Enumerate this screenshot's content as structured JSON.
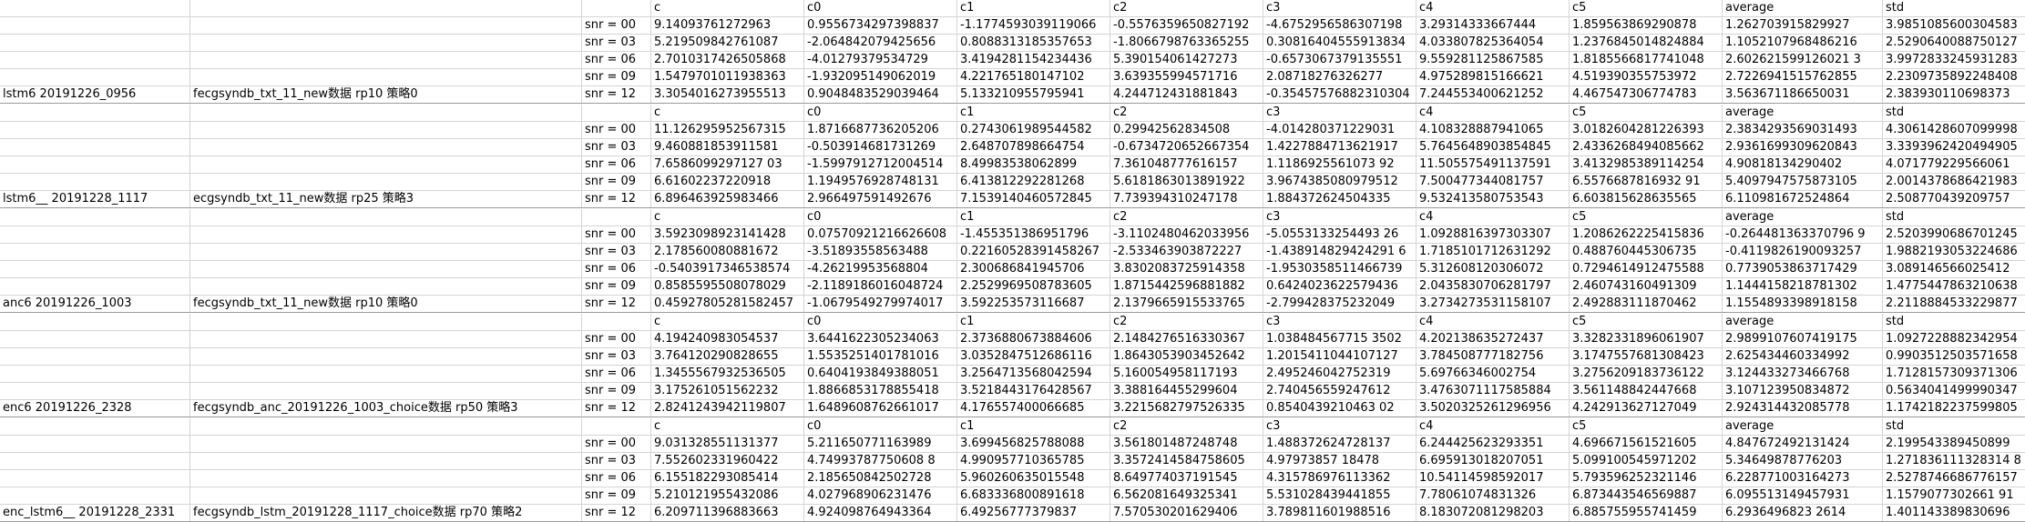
{
  "sheet": {
    "blocks": [
      {
        "model": "lstm6  20191226_0956",
        "desc": "fecgsyndb_txt_11_new数据   rp10  策略0",
        "headers": [
          "c",
          "c0",
          "c1",
          "c2",
          "c3",
          "c4",
          "c5",
          "average",
          "std"
        ],
        "rows": [
          {
            "snr": "snr = 00",
            "values": [
              "9.14093761272963",
              "0.9556734297398837",
              "-1.1774593039119066",
              "-0.5576359650827192",
              "-4.6752956586307198",
              "3.29314333667444",
              "1.859563869290878",
              "1.262703915829927",
              "3.9851085600304583"
            ]
          },
          {
            "snr": "snr = 03",
            "values": [
              "5.219509842761087",
              "-2.064842079425656",
              "0.8088313185357653",
              "-1.8066798763365255",
              "0.30816404555913834",
              "4.033807825364054",
              "1.2376845014824884",
              "1.1052107968486216",
              "2.5290640088750127"
            ]
          },
          {
            "snr": "snr = 06",
            "values": [
              "2.7010317426505868",
              "-4.01279379534729",
              "3.4194281154234436",
              "5.390154061427273",
              "-0.6573067379135551",
              "9.559281125867585",
              "1.8185566817741048",
              "2.602621599126021 3",
              "3.9972833245931283"
            ]
          },
          {
            "snr": "snr = 09",
            "values": [
              "1.5479701011938363",
              "-1.932095149062019",
              "4.221765180147102",
              "3.639355994571716",
              "2.08718276326277",
              "4.975289815166621",
              "4.519390355753972",
              "2.7226941515762855",
              "2.2309735892248408"
            ]
          },
          {
            "snr": "snr = 12",
            "values": [
              "3.3054016273955513",
              "0.9048483529039464",
              "5.133210955795941",
              "4.244712431881843",
              "-0.35457576882310304",
              "7.244553400621252",
              "4.467547306774783",
              "3.563671186650031",
              "2.383930110698373"
            ]
          }
        ]
      },
      {
        "model": "lstm6__  20191228_1117",
        "desc": "ecgsyndb_txt_11_new数据   rp25  策略3",
        "headers": [
          "c",
          "c0",
          "c1",
          "c2",
          "c3",
          "c4",
          "c5",
          "average",
          "std"
        ],
        "rows": [
          {
            "snr": "snr = 00",
            "values": [
              "11.126295952567315",
              "1.8716687736205206",
              "0.2743061989544582",
              "0.29942562834508",
              "-4.014280371229031",
              "4.108328887941065",
              "3.0182604281226393",
              "2.3834293569031493",
              "4.3061428607099998"
            ]
          },
          {
            "snr": "snr = 03",
            "values": [
              "9.460881853911581",
              "-0.503914681731269",
              "2.648707898664754",
              "-0.6734720652667354",
              "1.4227884713621917",
              "5.7645648903854845",
              "2.4336268494085662",
              "2.9361699309620843",
              "3.3393962420494905"
            ]
          },
          {
            "snr": "snr = 06",
            "values": [
              "7.6586099297127 03",
              "-1.5997912712004514",
              "8.49983538062899",
              "7.361048777616157",
              "1.1186925561073 92",
              "11.505575491137591",
              "3.4132985389114254",
              "4.90818134290402",
              "4.071779229566061"
            ]
          },
          {
            "snr": "snr = 09",
            "values": [
              "6.61602237220918",
              "1.1949576928748131",
              "6.413812292281268",
              "5.6181863013891922",
              "3.9674385080979512",
              "7.500477344081757",
              "6.5576687816932 91",
              "5.4097947575873105",
              "2.0014378686421983"
            ]
          },
          {
            "snr": "snr = 12",
            "values": [
              "6.896463925983466",
              "2.966497591492676",
              "7.1539140460572845",
              "7.739394310247178",
              "1.884372624504335",
              "9.532413580753543",
              "6.603815628635565",
              "6.110981672524864",
              "2.508770439209757"
            ]
          }
        ]
      },
      {
        "model": "anc6  20191226_1003",
        "desc": "fecgsyndb_txt_11_new数据   rp10  策略0",
        "headers": [
          "c",
          "c0",
          "c1",
          "c2",
          "c3",
          "c4",
          "c5",
          "average",
          "std"
        ],
        "rows": [
          {
            "snr": "snr = 00",
            "values": [
              "3.5923098923141428",
              "0.07570921216626608",
              "-1.455351386951796",
              "-3.1102480462033956",
              "-5.0553133254493 26",
              "1.0928816397303307",
              "1.2086262225415836",
              "-0.264481363370796 9",
              "2.5203990686701245"
            ]
          },
          {
            "snr": "snr = 03",
            "values": [
              "2.178560080881672",
              "-3.51893558563488",
              "0.22160528391458267",
              "-2.533463903872227",
              "-1.438914829424291 6",
              "1.7185101712631292",
              "0.488760445306735",
              "-0.4119826190093257",
              "1.9882193053224686"
            ]
          },
          {
            "snr": "snr = 06",
            "values": [
              "-0.5403917346538574",
              "-4.26219953568804",
              "2.300686841945706",
              "3.8302083725914358",
              "-1.9530358511466739",
              "5.312608120306072",
              "0.7294614912475588",
              "0.7739053863717429",
              "3.089146566025412"
            ]
          },
          {
            "snr": "snr = 09",
            "values": [
              "0.8585595508078029",
              "-2.1189186016048724",
              "2.2529969508783605",
              "1.8715442596881882",
              "0.6424023622579436",
              "2.0435830706281797",
              "2.460743160491309",
              "1.1444158218781302",
              "1.4775447863210638"
            ]
          },
          {
            "snr": "snr = 12",
            "values": [
              "0.45927805281582457",
              "-1.0679549279974017",
              "3.592253573116687",
              "2.1379665915533765",
              "-2.799428375232049",
              "3.2734273531158107",
              "2.492883111870462",
              "1.1554893398918158",
              "2.2118884533229877"
            ]
          }
        ]
      },
      {
        "model": "enc6  20191226_2328",
        "desc": "fecgsyndb_anc_20191226_1003_choice数据   rp50  策略3",
        "headers": [
          "c",
          "c0",
          "c1",
          "c2",
          "c3",
          "c4",
          "c5",
          "average",
          "std"
        ],
        "rows": [
          {
            "snr": "snr = 00",
            "values": [
              "4.194240983054537",
              "3.6441622305234063",
              "2.3736880673884606",
              "2.1484276516330367",
              "1.038484567715 3502",
              "4.202138635272437",
              "3.3282331896061907",
              "2.9899107607419175",
              "1.0927228882342954"
            ]
          },
          {
            "snr": "snr = 03",
            "values": [
              "3.764120290828655",
              "1.5535251401781016",
              "3.0352847512686116",
              "1.8643053903452642",
              "1.2015411044107127",
              "3.784508777182756",
              "3.1747557681308423",
              "2.625434460334992",
              "0.9903512503571658"
            ]
          },
          {
            "snr": "snr = 06",
            "values": [
              "1.3455567932536505",
              "0.6404193849388051",
              "3.2564713568042594",
              "5.160054958117193",
              "2.495246042752319",
              "5.69766346002754",
              "3.2756209183736122",
              "3.124433273466768",
              "1.7128157309371306"
            ]
          },
          {
            "snr": "snr = 09",
            "values": [
              "3.175261051562232",
              "1.8866853178855418",
              "3.5218443176428567",
              "3.388164455299604",
              "2.740456559247612",
              "3.4763071117585884",
              "3.561148842447668",
              "3.107123950834872",
              "0.5634041499990347"
            ]
          },
          {
            "snr": "snr = 12",
            "values": [
              "2.8241243942119807",
              "1.6489608762661017",
              "4.176557400066685",
              "3.2215682797526335",
              "0.8540439210463 02",
              "3.5020325261296956",
              "4.242913627127049",
              "2.924314432085778",
              "1.1742182237599805"
            ]
          }
        ]
      },
      {
        "model": "enc_lstm6__  20191228_2331",
        "desc": "fecgsyndb_lstm_20191228_1117_choice数据   rp70  策略2",
        "headers": [
          "c",
          "c0",
          "c1",
          "c2",
          "c3",
          "c4",
          "c5",
          "average",
          "std"
        ],
        "rows": [
          {
            "snr": "snr = 00",
            "values": [
              "9.031328551131377",
              "5.211650771163989",
              "3.699456825788088",
              "3.561801487248748",
              "1.488372624728137",
              "6.244425623293351",
              "4.696671561521605",
              "4.847672492131424",
              "2.199543389450899"
            ]
          },
          {
            "snr": "snr = 03",
            "values": [
              "7.552602331960422",
              "4.74993787750608 8",
              "4.990957710365785",
              "3.3572414584758605",
              "4.97973857 18478",
              "6.695913018207051",
              "5.099100545971202",
              "5.34649878776203",
              "1.271836111328314 8"
            ]
          },
          {
            "snr": "snr = 06",
            "values": [
              "6.155182293085414",
              "2.185650842502728",
              "5.960260635015548",
              "8.649774037191545",
              "4.315786976113362",
              "10.54114598592017",
              "5.793596252321146",
              "6.228771003164273",
              "2.5278746686776157"
            ]
          },
          {
            "snr": "snr = 09",
            "values": [
              "5.210121955432086",
              "4.027968906231476",
              "6.683336800891618",
              "6.562081649325341",
              "5.531028439441855",
              "7.78061074831326",
              "6.873443546569887",
              "6.095513149457931",
              "1.1579077302661 91"
            ]
          },
          {
            "snr": "snr = 12",
            "values": [
              "6.209711396883663",
              "4.924098764943364",
              "6.49256777379837",
              "7.570530201629406",
              "3.789811601988516",
              "8.183072081298203",
              "6.885755955741459",
              "6.2936496823 2614",
              "1.401143389830696"
            ]
          }
        ]
      }
    ]
  }
}
